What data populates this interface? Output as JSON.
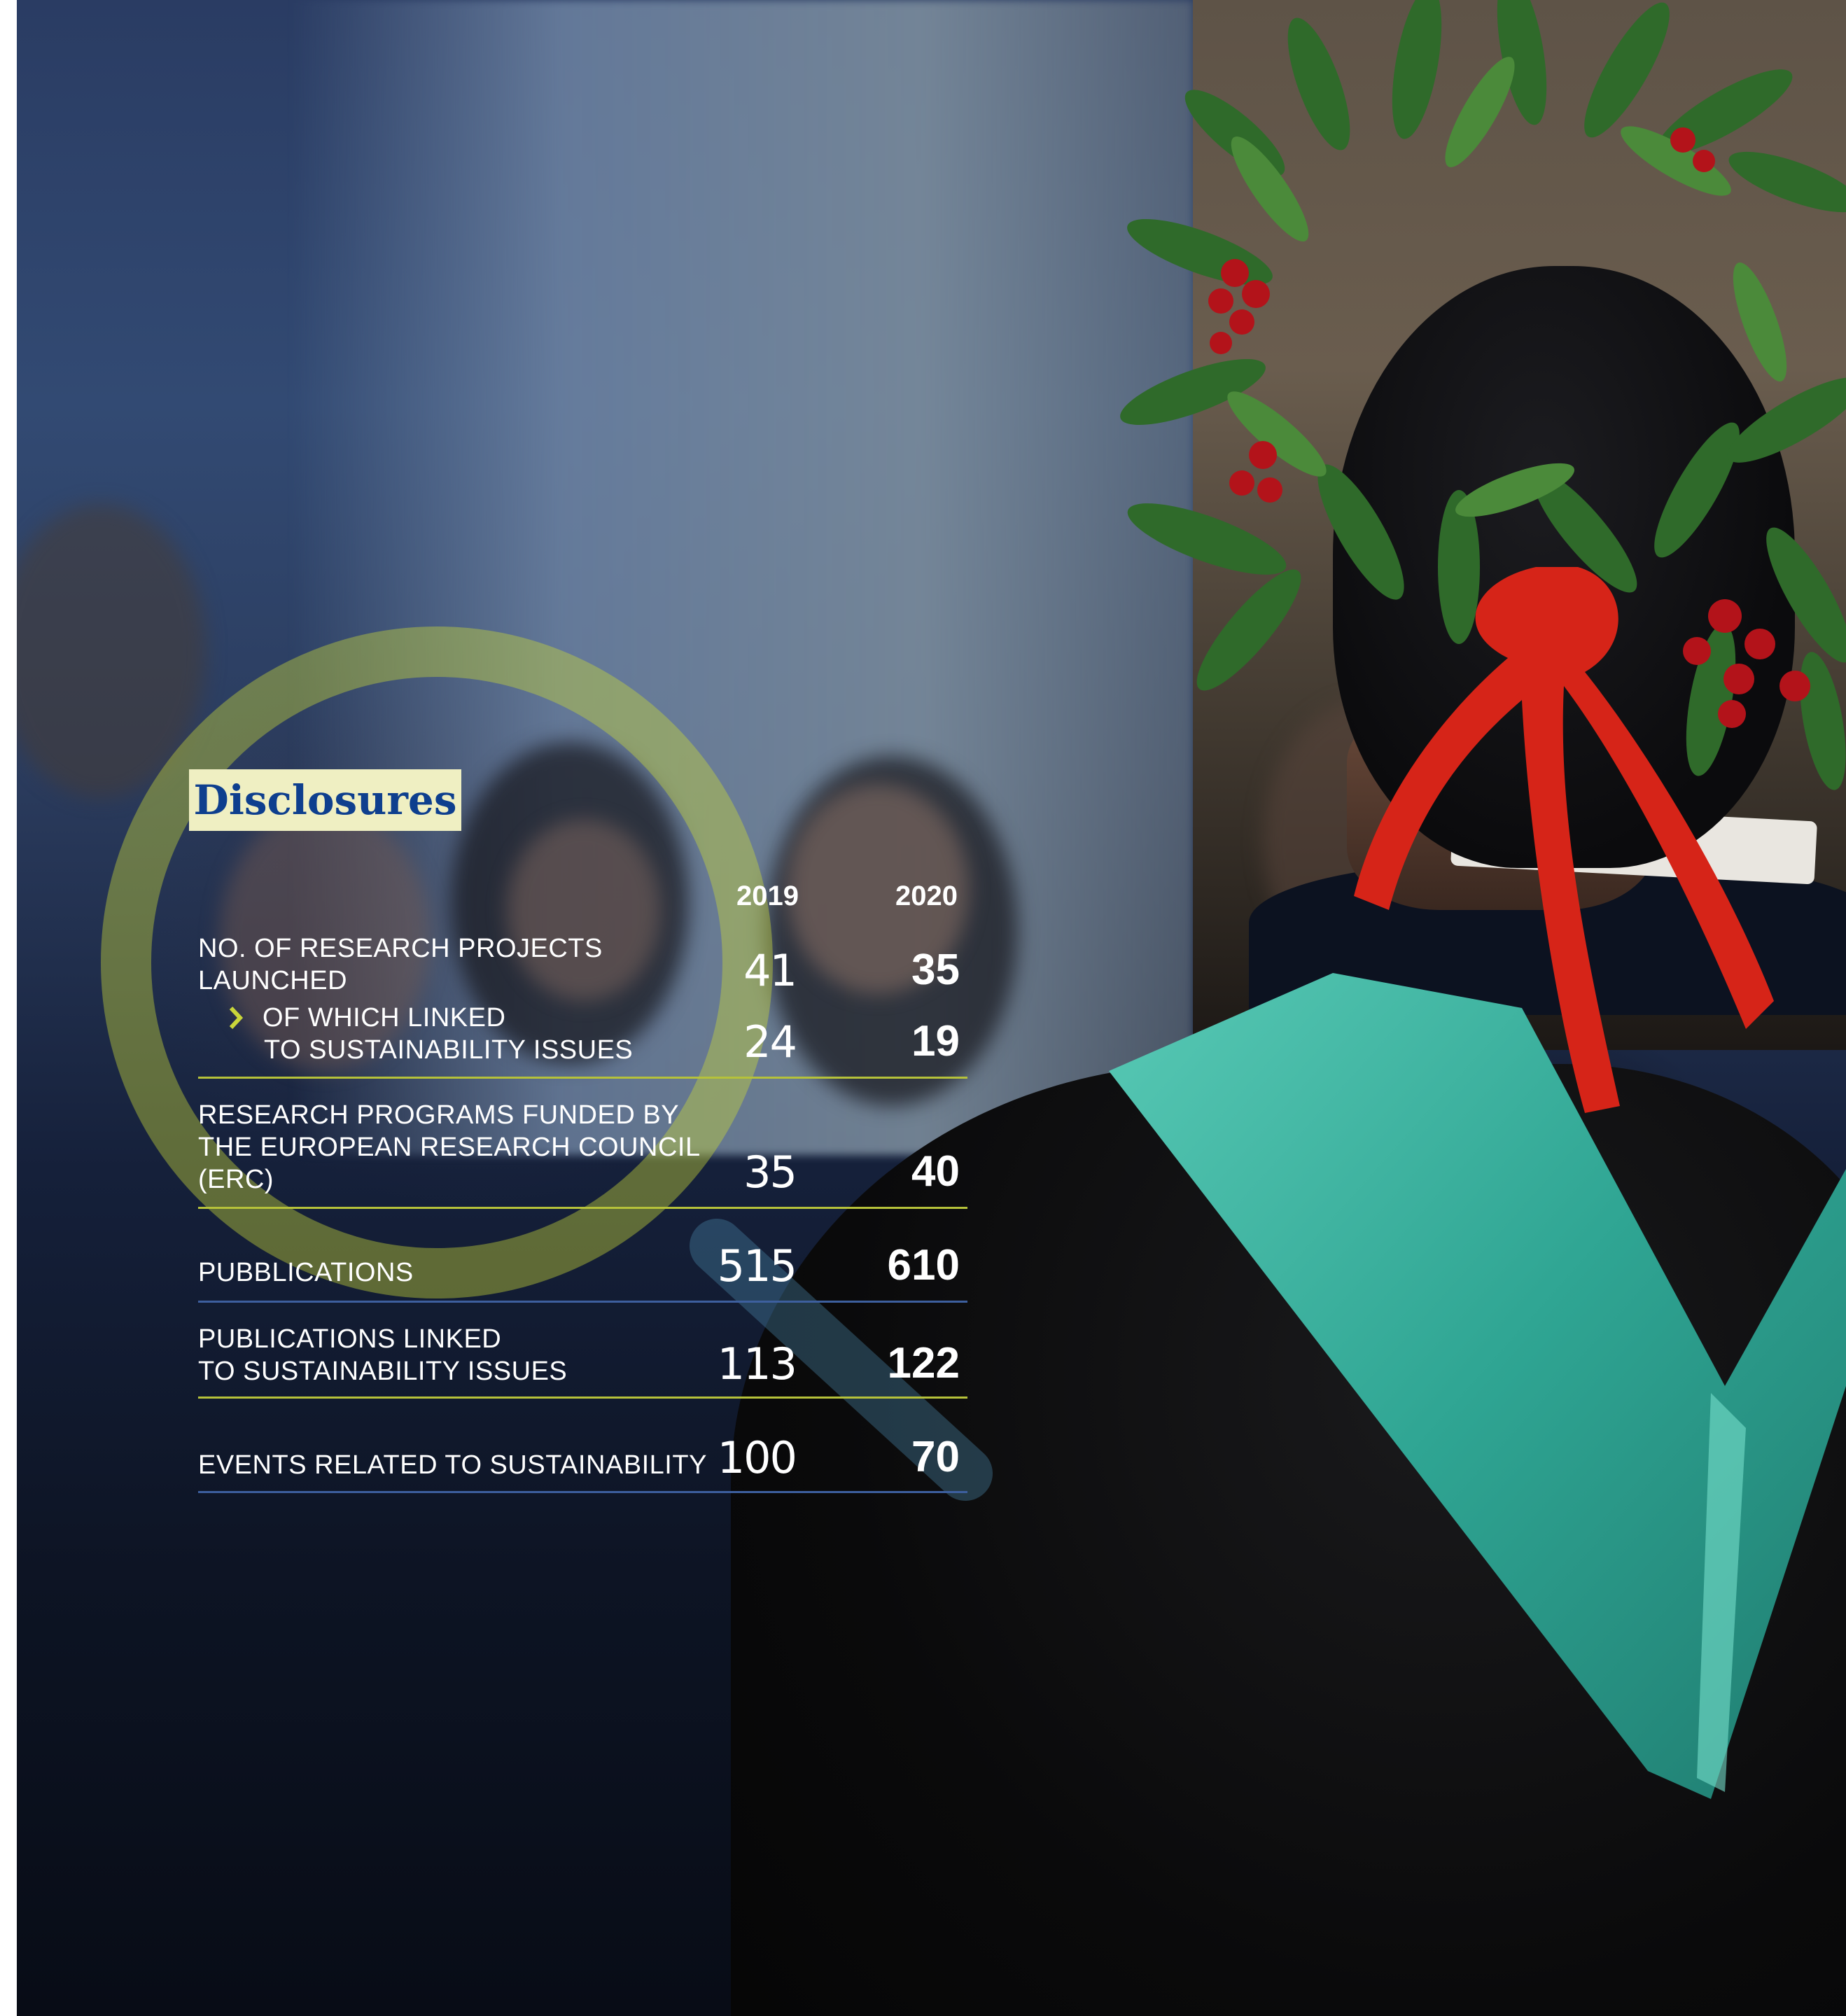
{
  "title": "Disclosures",
  "columns": [
    "2019",
    "2020"
  ],
  "rows": [
    {
      "label_lines": [
        "NO. OF RESEARCH PROJECTS",
        "LAUNCHED"
      ],
      "v2019": "41",
      "v2020": "35"
    },
    {
      "label_lines": [
        "OF WHICH LINKED",
        "TO SUSTAINABILITY ISSUES"
      ],
      "v2019": "24",
      "v2020": "19",
      "sub": true
    },
    {
      "label_lines": [
        "RESEARCH PROGRAMS FUNDED BY",
        "THE EUROPEAN RESEARCH COUNCIL",
        "(ERC)"
      ],
      "v2019": "35",
      "v2020": "40"
    },
    {
      "label_lines": [
        "PUBBLICATIONS"
      ],
      "v2019": "515",
      "v2020": "610"
    },
    {
      "label_lines": [
        "PUBLICATIONS LINKED",
        "TO SUSTAINABILITY ISSUES"
      ],
      "v2019": "113",
      "v2020": "122"
    },
    {
      "label_lines": [
        "EVENTS RELATED TO SUSTAINABILITY"
      ],
      "v2019": "100",
      "v2020": "70"
    }
  ],
  "colors": {
    "title_bg": "#efefc2",
    "title_text": "#0e3f8e",
    "accent_green": "#c9d63a",
    "rule_green": "#b6c23a",
    "rule_blue": "#3d5f9e"
  },
  "icons": [
    "magnifier-graphic",
    "chevron-right-icon"
  ]
}
